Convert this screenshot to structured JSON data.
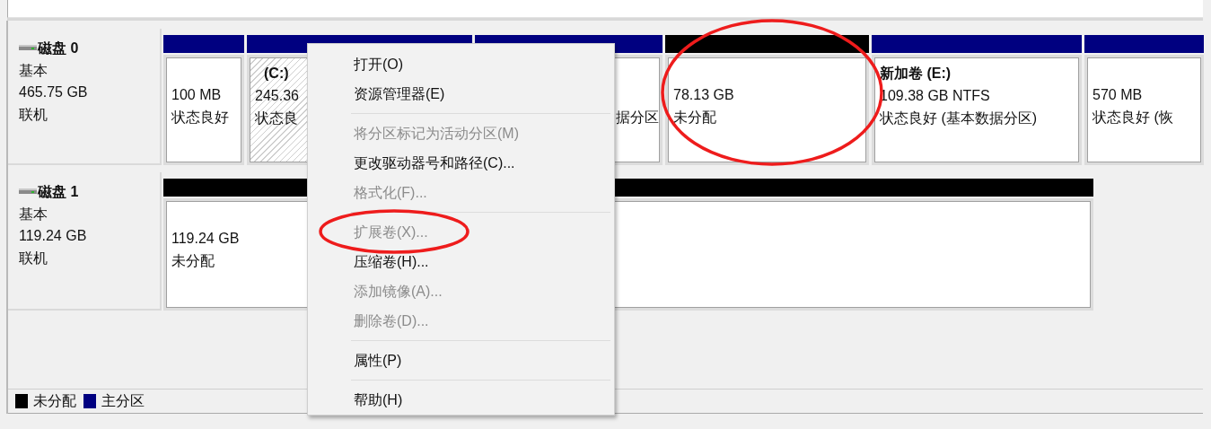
{
  "disks": [
    {
      "name": "磁盘 0",
      "type": "基本",
      "size": "465.75 GB",
      "status": "联机",
      "partitions": [
        {
          "kind": "primary",
          "selected": false,
          "circled": false,
          "lines": [
            "100 MB",
            "状态良好"
          ]
        },
        {
          "kind": "primary",
          "selected": true,
          "circled": false,
          "title": "(C:)",
          "lines": [
            "245.36",
            "状态良"
          ]
        },
        {
          "kind": "primary",
          "selected": false,
          "circled": false,
          "lines": [
            "据分区"
          ]
        },
        {
          "kind": "unallocated",
          "selected": false,
          "circled": true,
          "lines": [
            "78.13 GB",
            "未分配"
          ]
        },
        {
          "kind": "primary",
          "selected": false,
          "circled": false,
          "title": "新加卷  (E:)",
          "lines": [
            "109.38 GB NTFS",
            "状态良好 (基本数据分区)"
          ]
        },
        {
          "kind": "primary",
          "selected": false,
          "circled": false,
          "lines": [
            "570 MB",
            "状态良好 (恢"
          ]
        }
      ]
    },
    {
      "name": "磁盘 1",
      "type": "基本",
      "size": "119.24 GB",
      "status": "联机",
      "partitions": [
        {
          "kind": "unallocated",
          "selected": false,
          "circled": false,
          "lines": [
            "119.24 GB",
            "未分配"
          ]
        }
      ]
    }
  ],
  "legend": [
    {
      "kind": "unallocated",
      "label": "未分配"
    },
    {
      "kind": "primary",
      "label": "主分区"
    }
  ],
  "context_menu": [
    {
      "kind": "item",
      "label": "打开(O)",
      "disabled": false,
      "circled": false
    },
    {
      "kind": "item",
      "label": "资源管理器(E)",
      "disabled": false,
      "circled": false
    },
    {
      "kind": "separator"
    },
    {
      "kind": "item",
      "label": "将分区标记为活动分区(M)",
      "disabled": true,
      "circled": false
    },
    {
      "kind": "item",
      "label": "更改驱动器号和路径(C)...",
      "disabled": false,
      "circled": false
    },
    {
      "kind": "item",
      "label": "格式化(F)...",
      "disabled": true,
      "circled": false
    },
    {
      "kind": "separator"
    },
    {
      "kind": "item",
      "label": "扩展卷(X)...",
      "disabled": true,
      "circled": true
    },
    {
      "kind": "item",
      "label": "压缩卷(H)...",
      "disabled": false,
      "circled": false
    },
    {
      "kind": "item",
      "label": "添加镜像(A)...",
      "disabled": true,
      "circled": false
    },
    {
      "kind": "item",
      "label": "删除卷(D)...",
      "disabled": true,
      "circled": false
    },
    {
      "kind": "separator"
    },
    {
      "kind": "item",
      "label": "属性(P)",
      "disabled": false,
      "circled": false
    },
    {
      "kind": "separator"
    },
    {
      "kind": "item",
      "label": "帮助(H)",
      "disabled": false,
      "circled": false
    }
  ]
}
